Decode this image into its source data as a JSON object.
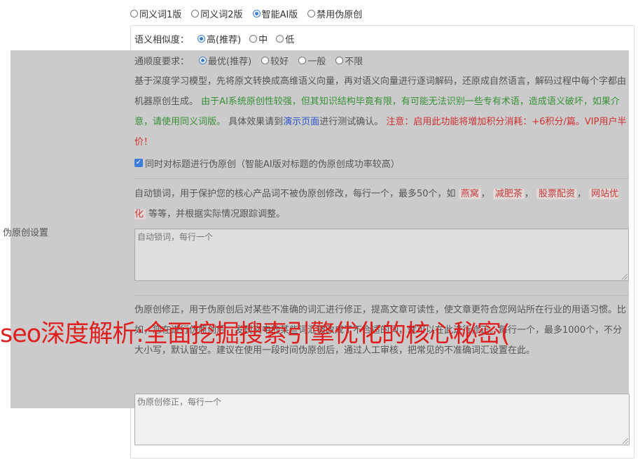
{
  "mode_options": [
    {
      "label": "同义词1版",
      "selected": false
    },
    {
      "label": "同义词2版",
      "selected": false
    },
    {
      "label": "智能AI版",
      "selected": true
    },
    {
      "label": "禁用伪原创",
      "selected": false
    }
  ],
  "similarity": {
    "label": "语义相似度：",
    "options": [
      {
        "label": "高(推荐)",
        "selected": true
      },
      {
        "label": "中",
        "selected": false
      },
      {
        "label": "低",
        "selected": false
      }
    ]
  },
  "fluency": {
    "label": "通顺度要求：",
    "options": [
      {
        "label": "最优(推荐)",
        "selected": true
      },
      {
        "label": "较好",
        "selected": false
      },
      {
        "label": "一般",
        "selected": false
      },
      {
        "label": "不限",
        "selected": false
      }
    ]
  },
  "side_label": "伪原创设置",
  "description": {
    "intro": "基于深度学习模型，先将原文转换成高维语义向量，再对语义向量进行逐词解码，还原成自然语言，解码过程中每个字都由机器原创生成。",
    "green_text": "由于AI系统原创性较强，但其知识结构毕竟有限，有可能无法识别一些专有术语，造成语义破坏，如果介意，请使用同义词版。",
    "effect_prefix": "具体效果请到",
    "demo_link": "演示页面",
    "effect_suffix": "进行测试确认。",
    "red_text": "注意：启用此功能将增加积分消耗：+6积分/篇。VIP用户半价！"
  },
  "title_checkbox": {
    "checked": true,
    "label": "同时对标题进行伪原创（智能AI版对标题的伪原创成功率较高）"
  },
  "lock_words": {
    "desc_prefix": "自动锁词，用于保护您的核心产品词不被伪原创修改，每行一个，最多50个，如",
    "examples": [
      "燕窝",
      "减肥茶",
      "股票配资",
      "网站优化"
    ],
    "desc_suffix": "等等，并根据实际情况跟踪调整。",
    "placeholder": "自动锁词，每行一个"
  },
  "correction": {
    "line1": "伪原创修正，用于伪原创后对某些不准确的词汇进行修正，提高文章可读性，使文章更符合您网站所在行业的用语习惯。比如，您在进行伪原创后，发现文中的某些词汇被改成了不合适的词，就可以在此进行修正。每行一",
    "line2": "个，最多1000个，不分大小写，默认留空。建议在使用一段时间伪原创后，通过人工审核，把常见的不准确词汇设置在此。",
    "placeholder": "伪原创修正，每行一个"
  },
  "overlay_title": "seo深度解析:全面挖掘搜索引擎优化的核心秘密(",
  "colors": {
    "accent": "#3b7dd8",
    "green": "#3a8f3a",
    "red": "#d03030",
    "overlay": "#e02020"
  }
}
